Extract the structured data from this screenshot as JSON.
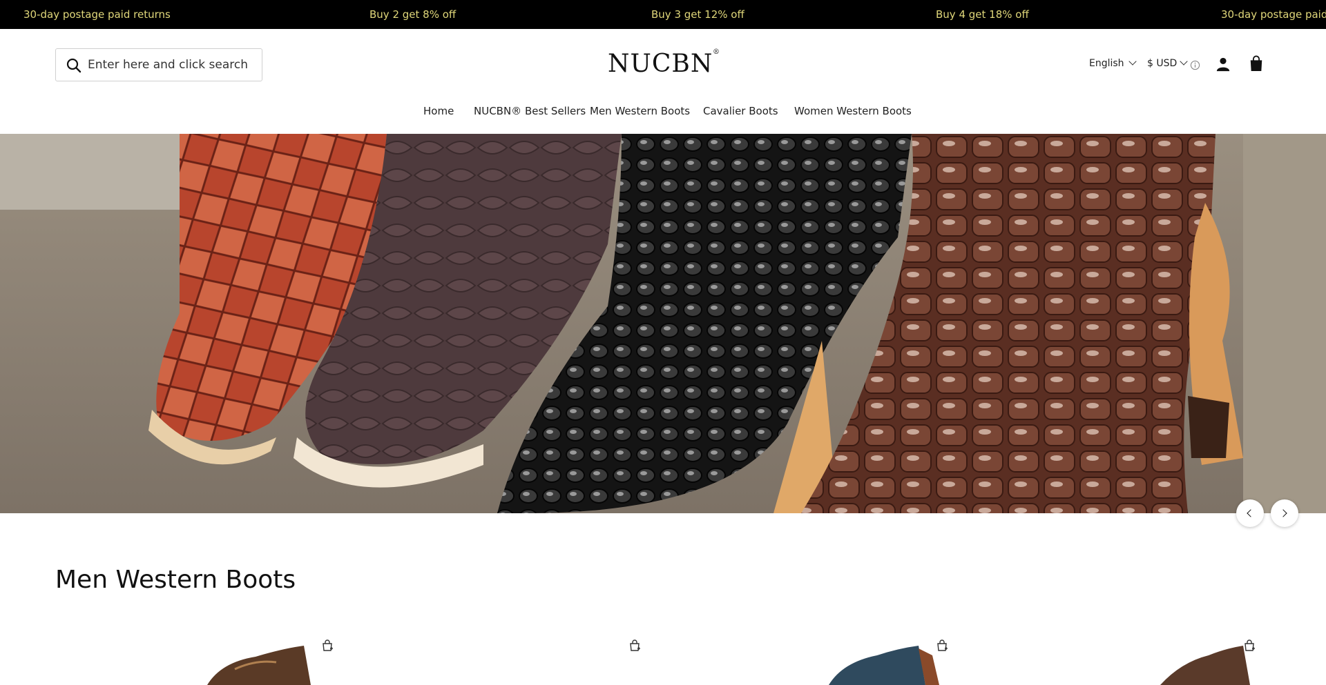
{
  "announcement": {
    "items": [
      "30-day postage paid returns",
      "Buy 2 get 8% off",
      "Buy 3 get 12% off",
      "Buy 4 get 18% off",
      "30-day postage paid returns"
    ],
    "text_color": "#e0d77a",
    "background": "#000000"
  },
  "header": {
    "search": {
      "placeholder": "Enter here and click search",
      "icon": "search-icon"
    },
    "logo": {
      "text": "NUCBN",
      "mark": "®"
    },
    "language": "English",
    "currency": "$ USD",
    "icons": [
      "info-icon",
      "account-icon",
      "shopping-bag-icon"
    ]
  },
  "nav": {
    "items": [
      {
        "label": "Home"
      },
      {
        "label": "NUCBN® Best Sellers"
      },
      {
        "label": "Men Western Boots"
      },
      {
        "label": "Cavalier Boots"
      },
      {
        "label": "Women Western Boots"
      }
    ]
  },
  "hero": {
    "description_icon": "hero-boots-image",
    "controls": [
      "chevron-left-icon",
      "chevron-right-icon"
    ]
  },
  "section": {
    "title": "Men Western Boots",
    "product_icons": [
      "add-to-cart-icon",
      "add-to-cart-icon",
      "add-to-cart-icon",
      "add-to-cart-icon"
    ]
  }
}
